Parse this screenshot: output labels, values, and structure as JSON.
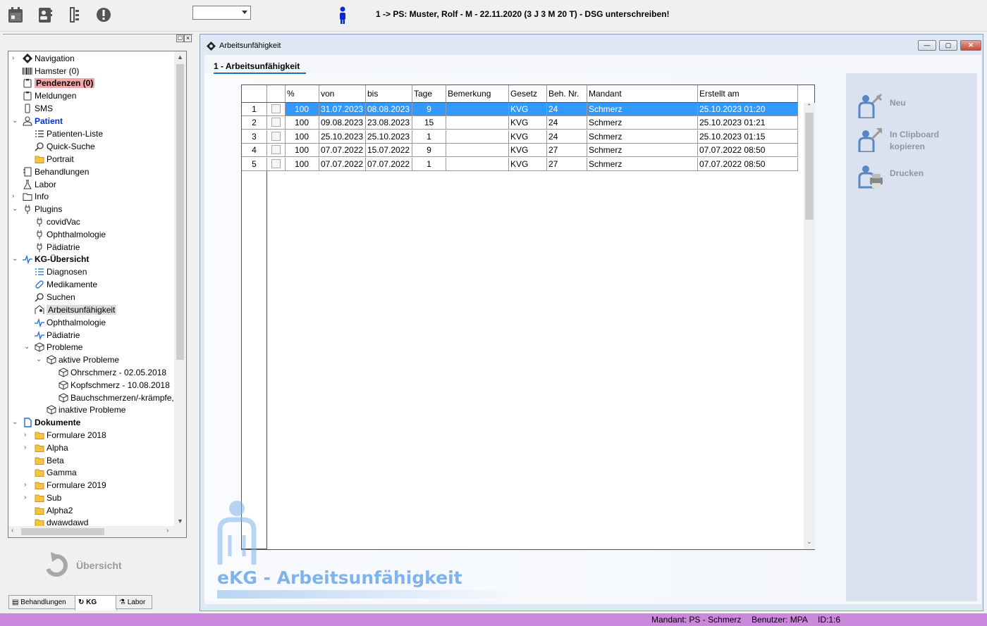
{
  "toolbar": {
    "icons": [
      "calendar-icon",
      "contact-card-icon",
      "tree-list-icon",
      "alert-icon"
    ],
    "combo_value": "",
    "patient_title": "1 -> PS: Muster, Rolf - M - 22.11.2020 (3 J 3 M 20 T) - DSG unterschreiben!"
  },
  "tree": {
    "items": [
      {
        "label": "Navigation"
      },
      {
        "label": "Hamster (0)"
      },
      {
        "label": "Pendenzen (0)"
      },
      {
        "label": "Meldungen"
      },
      {
        "label": "SMS"
      },
      {
        "label": "Patient"
      },
      {
        "label": "Patienten-Liste"
      },
      {
        "label": "Quick-Suche"
      },
      {
        "label": "Portrait"
      },
      {
        "label": "Behandlungen"
      },
      {
        "label": "Labor"
      },
      {
        "label": "Info"
      },
      {
        "label": "Plugins"
      },
      {
        "label": "covidVac"
      },
      {
        "label": "Ophthalmologie"
      },
      {
        "label": "Pädiatrie"
      },
      {
        "label": "KG-Übersicht"
      },
      {
        "label": "Diagnosen"
      },
      {
        "label": "Medikamente"
      },
      {
        "label": "Suchen"
      },
      {
        "label": "Arbeitsunfähigkeit"
      },
      {
        "label": "Ophthalmologie"
      },
      {
        "label": "Pädiatrie"
      },
      {
        "label": "Probleme"
      },
      {
        "label": "aktive Probleme"
      },
      {
        "label": "Ohrschmerz - 02.05.2018"
      },
      {
        "label": "Kopfschmerz - 10.08.2018"
      },
      {
        "label": "Bauchschmerzen/-krämpfe,"
      },
      {
        "label": "inaktive Probleme"
      },
      {
        "label": "Dokumente"
      },
      {
        "label": "Formulare 2018"
      },
      {
        "label": "Alpha"
      },
      {
        "label": "Beta"
      },
      {
        "label": "Gamma"
      },
      {
        "label": "Formulare 2019"
      },
      {
        "label": "Sub"
      },
      {
        "label": "Alpha2"
      },
      {
        "label": "dwawdawd"
      }
    ]
  },
  "overview_button": "Übersicht",
  "bottom_tabs": [
    "Behandlungen",
    "KG",
    "Labor"
  ],
  "window": {
    "title": "Arbeitsunfähigkeit",
    "tab": "1 - Arbeitsunfähigkeit"
  },
  "grid": {
    "columns": [
      "",
      "",
      "%",
      "von",
      "bis",
      "Tage",
      "Bemerkung",
      "Gesetz",
      "Beh. Nr.",
      "Mandant",
      "Erstellt am"
    ],
    "rows": [
      [
        "1",
        "",
        "100",
        "31.07.2023",
        "08.08.2023",
        "9",
        "",
        "KVG",
        "24",
        "Schmerz",
        "25.10.2023 01:20"
      ],
      [
        "2",
        "",
        "100",
        "09.08.2023",
        "23.08.2023",
        "15",
        "",
        "KVG",
        "24",
        "Schmerz",
        "25.10.2023 01:21"
      ],
      [
        "3",
        "",
        "100",
        "25.10.2023",
        "25.10.2023",
        "1",
        "",
        "KVG",
        "24",
        "Schmerz",
        "25.10.2023 01:15"
      ],
      [
        "4",
        "",
        "100",
        "07.07.2022",
        "15.07.2022",
        "9",
        "",
        "KVG",
        "27",
        "Schmerz",
        "07.07.2022 08:50"
      ],
      [
        "5",
        "",
        "100",
        "07.07.2022",
        "07.07.2022",
        "1",
        "",
        "KVG",
        "27",
        "Schmerz",
        "07.07.2022 08:50"
      ]
    ],
    "selected_row": 0
  },
  "actions": [
    {
      "label": "Neu",
      "icon": "new-incapacity-icon"
    },
    {
      "label": "In Clipboard kopieren",
      "icon": "clipboard-copy-icon"
    },
    {
      "label": "Drucken",
      "icon": "print-icon"
    }
  ],
  "watermark": "eKG - Arbeitsunfähigkeit",
  "status": {
    "mandant": "Mandant: PS - Schmerz",
    "benutzer": "Benutzer: MPA",
    "id": "ID:1:6"
  },
  "colors": {
    "selection": "#3399ff",
    "accent_blue": "#1c6ec9",
    "status_bar": "#cc88dd",
    "pendenzen_highlight": "#f4a7a7"
  }
}
